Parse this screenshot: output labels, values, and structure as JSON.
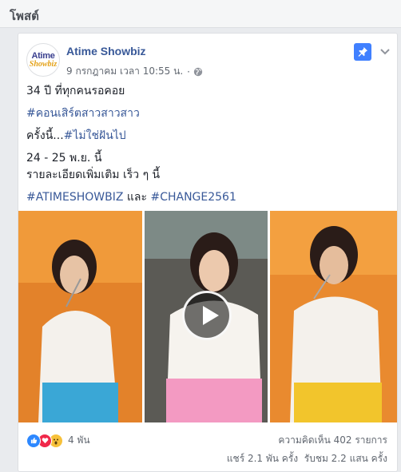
{
  "section": {
    "title": "โพสต์"
  },
  "post": {
    "avatar": {
      "line1": "Atime",
      "line2": "Showbiz"
    },
    "page_name": "Atime Showbiz",
    "timestamp": "9 กรกฎาคม เวลา 10:55 น.",
    "separator": "·",
    "privacy_icon": "globe-icon",
    "pin_icon": "pin-icon",
    "menu_icon": "chevron-down-icon",
    "body": {
      "line1": "34 ปี ที่ทุกคนรอคอย",
      "hashtag1": "#คอนเสิร์ตสาวสาวสาว",
      "line3_prefix": "ครั้งนี้...",
      "hashtag2": "#ไม่ใช่ฝันไป",
      "line4": "24 - 25 พ.ย. นี้",
      "line5": "รายละเอียดเพิ่มเติม เร็ว ๆ นี้",
      "hashtag3": "#ATIMESHOWBIZ",
      "and_word": " และ ",
      "hashtag4": "#CHANGE2561"
    },
    "video": {
      "play_icon": "play-icon"
    },
    "stats": {
      "reactions_count": "4 พัน",
      "comments": "ความคิดเห็น 402 รายการ",
      "shares": "แชร์ 2.1 พัน ครั้ง",
      "views": "รับชม 2.2 แสน ครั้ง"
    },
    "colors": {
      "link": "#385898",
      "pin": "#4080ff"
    }
  }
}
